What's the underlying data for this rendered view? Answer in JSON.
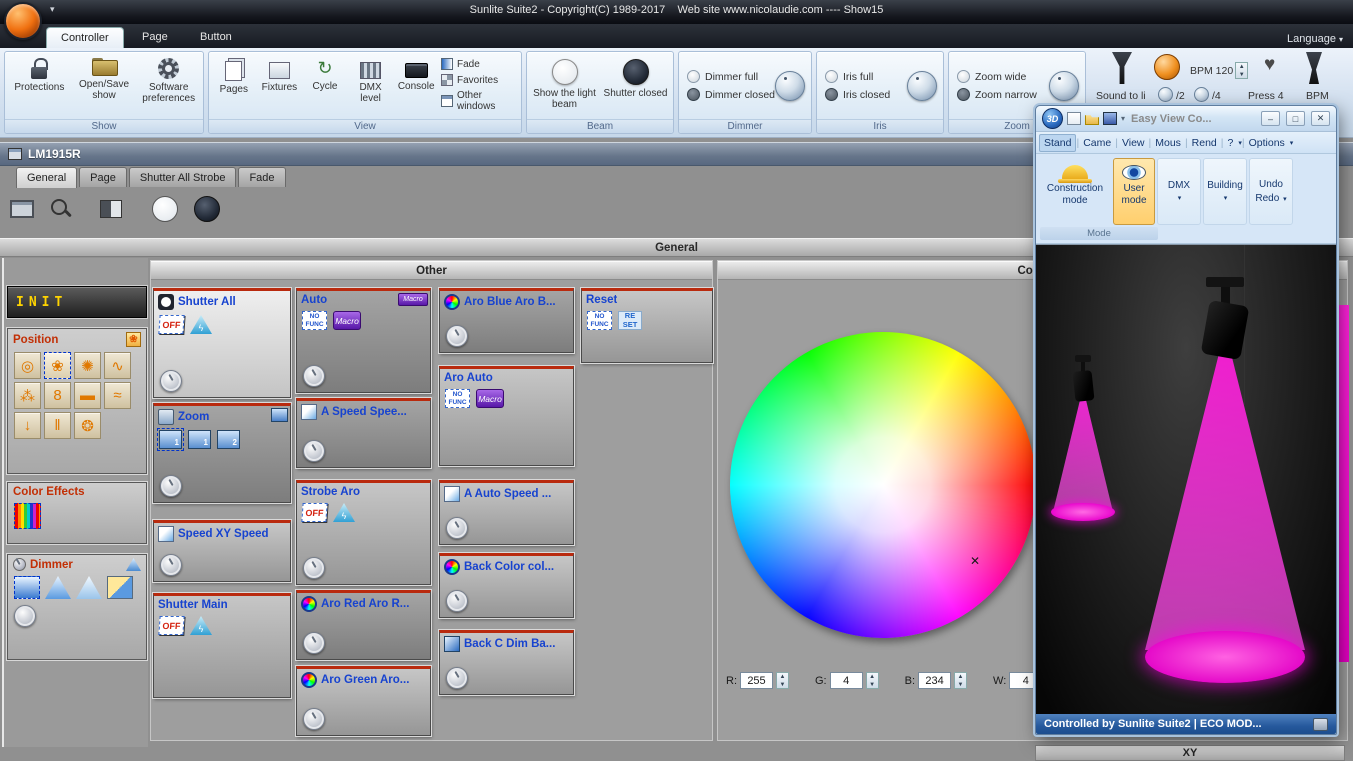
{
  "titlebar": {
    "title": "Sunlite Suite2 - Copyright(C) 1989-2017    Web site www.nicolaudie.com ---- Show15",
    "language": "Language"
  },
  "ribbon_tabs": [
    {
      "label": "Controller",
      "active": true
    },
    {
      "label": "Page",
      "active": false
    },
    {
      "label": "Button",
      "active": false
    }
  ],
  "ribbon": {
    "show": {
      "label": "Show",
      "buttons": [
        {
          "label": "Protections",
          "icon": "lock-icon"
        },
        {
          "label": "Open/Save show",
          "icon": "folder-icon"
        },
        {
          "label": "Software preferences",
          "icon": "gear-icon"
        }
      ]
    },
    "view": {
      "label": "View",
      "buttons": [
        {
          "label": "Pages",
          "icon": "pages-icon"
        },
        {
          "label": "Fixtures",
          "icon": "fixtures-icon"
        },
        {
          "label": "Cycle",
          "icon": "cycle-icon"
        },
        {
          "label": "DMX level",
          "icon": "dmx-level-icon"
        },
        {
          "label": "Console",
          "icon": "console-icon"
        }
      ],
      "menu_items": [
        {
          "label": "Fade",
          "icon": "fade-icon"
        },
        {
          "label": "Favorites",
          "icon": "favorites-icon"
        },
        {
          "label": "Other windows",
          "icon": "other-windows-icon"
        }
      ]
    },
    "beam": {
      "label": "Beam",
      "items": [
        {
          "label": "Show the light beam"
        },
        {
          "label": "Shutter closed"
        }
      ]
    },
    "dimmer": {
      "label": "Dimmer",
      "items": [
        {
          "label": "Dimmer full"
        },
        {
          "label": "Dimmer closed"
        }
      ]
    },
    "iris": {
      "label": "Iris",
      "items": [
        {
          "label": "Iris full"
        },
        {
          "label": "Iris closed"
        }
      ]
    },
    "zoom": {
      "label": "Zoom",
      "items": [
        {
          "label": "Zoom wide"
        },
        {
          "label": "Zoom narrow"
        }
      ]
    },
    "audio": {
      "bpm_label": "BPM 120",
      "sound_to_light": "Sound to li",
      "div2": "/2",
      "div4": "/4",
      "press": "Press 4",
      "bpm": "BPM"
    }
  },
  "window_title": "LM1915R",
  "page_tabs": [
    {
      "label": "General",
      "active": true
    },
    {
      "label": "Page",
      "active": false
    },
    {
      "label": "Shutter All Strobe",
      "active": false
    },
    {
      "label": "Fade",
      "active": false
    }
  ],
  "general_bar": "General",
  "left_panel": {
    "init": "INIT",
    "position": {
      "title": "Position",
      "gobos": [
        "gobo-rings",
        "gobo-flower",
        "gobo-swirl",
        "gobo-squiggle",
        "gobo-double-spiral",
        "gobo-eight",
        "gobo-dash",
        "gobo-waves",
        "gobo-arrow",
        "gobo-bars",
        "gobo-shell"
      ]
    },
    "color_effects": {
      "title": "Color Effects"
    },
    "dimmer": {
      "title": "Dimmer"
    }
  },
  "other_panel": {
    "header": "Other",
    "buttons": [
      {
        "name": "shutter-all",
        "title": "Shutter All",
        "title_icon": "shutter-circle",
        "icons": [
          "off",
          "lightning"
        ],
        "dial": true,
        "highlight": true
      },
      {
        "name": "zoom",
        "title": "Zoom",
        "title_icon": "zoom-lens",
        "corner_icon": "fixtures-badge",
        "icons": [
          "fix1-sel",
          "fix1",
          "fix2"
        ],
        "dial": true,
        "pressed": true
      },
      {
        "name": "speed-xy-speed",
        "title": "Speed XY Speed",
        "title_icon": "speed",
        "dial": true
      },
      {
        "name": "shutter-main",
        "title": "Shutter Main",
        "icons": [
          "off",
          "lightning"
        ],
        "dial": false
      },
      {
        "name": "auto",
        "title": "Auto",
        "corner_icon": "macro-badge",
        "icons": [
          "nofunc",
          "macro"
        ],
        "dial": true,
        "pressed": true
      },
      {
        "name": "a-speed",
        "title": "A Speed Spee...",
        "title_icon": "speed",
        "dial": true,
        "pressed": true
      },
      {
        "name": "strobe-aro",
        "title": "Strobe Aro",
        "icons": [
          "off",
          "lightning"
        ],
        "dial": true
      },
      {
        "name": "aro-red",
        "title": "Aro Red Aro R...",
        "title_icon": "color-wheel",
        "dial": true,
        "pressed": true
      },
      {
        "name": "aro-green",
        "title": "Aro Green Aro...",
        "title_icon": "color-wheel",
        "dial": true
      },
      {
        "name": "aro-blue",
        "title": "Aro Blue Aro B...",
        "title_icon": "color-wheel",
        "dial": true,
        "pressed": true
      },
      {
        "name": "aro-auto",
        "title": "Aro Auto",
        "icons": [
          "nofunc",
          "macro"
        ],
        "dial": false
      },
      {
        "name": "a-auto-speed",
        "title": "A Auto Speed ...",
        "title_icon": "speed",
        "dial": true
      },
      {
        "name": "back-color",
        "title": "Back Color col...",
        "title_icon": "color-wheel",
        "dial": true
      },
      {
        "name": "back-c-dim",
        "title": "Back C Dim Ba...",
        "title_icon": "blue-square",
        "dial": true
      },
      {
        "name": "reset",
        "title": "Reset",
        "icons": [
          "nofunc",
          "reset"
        ],
        "dial": false
      }
    ]
  },
  "color_panel": {
    "header": "Color",
    "r_label": "R:",
    "r_value": "255",
    "g_label": "G:",
    "g_value": "4",
    "b_label": "B:",
    "b_value": "234",
    "w_label": "W:",
    "w_value": "4"
  },
  "xy_panel": {
    "header": "XY"
  },
  "easyview": {
    "title": "Easy View  Co...",
    "menu": [
      "Stand",
      "Came",
      "View",
      "Mous",
      "Rend",
      "?",
      "Options"
    ],
    "toolbar": {
      "construction": "Construction mode",
      "user": "User mode",
      "dmx": "DMX",
      "building": "Building",
      "undo": "Undo",
      "redo": "Redo",
      "group_label": "Mode"
    },
    "status": "Controlled by Sunlite Suite2  |  ECO MOD..."
  }
}
